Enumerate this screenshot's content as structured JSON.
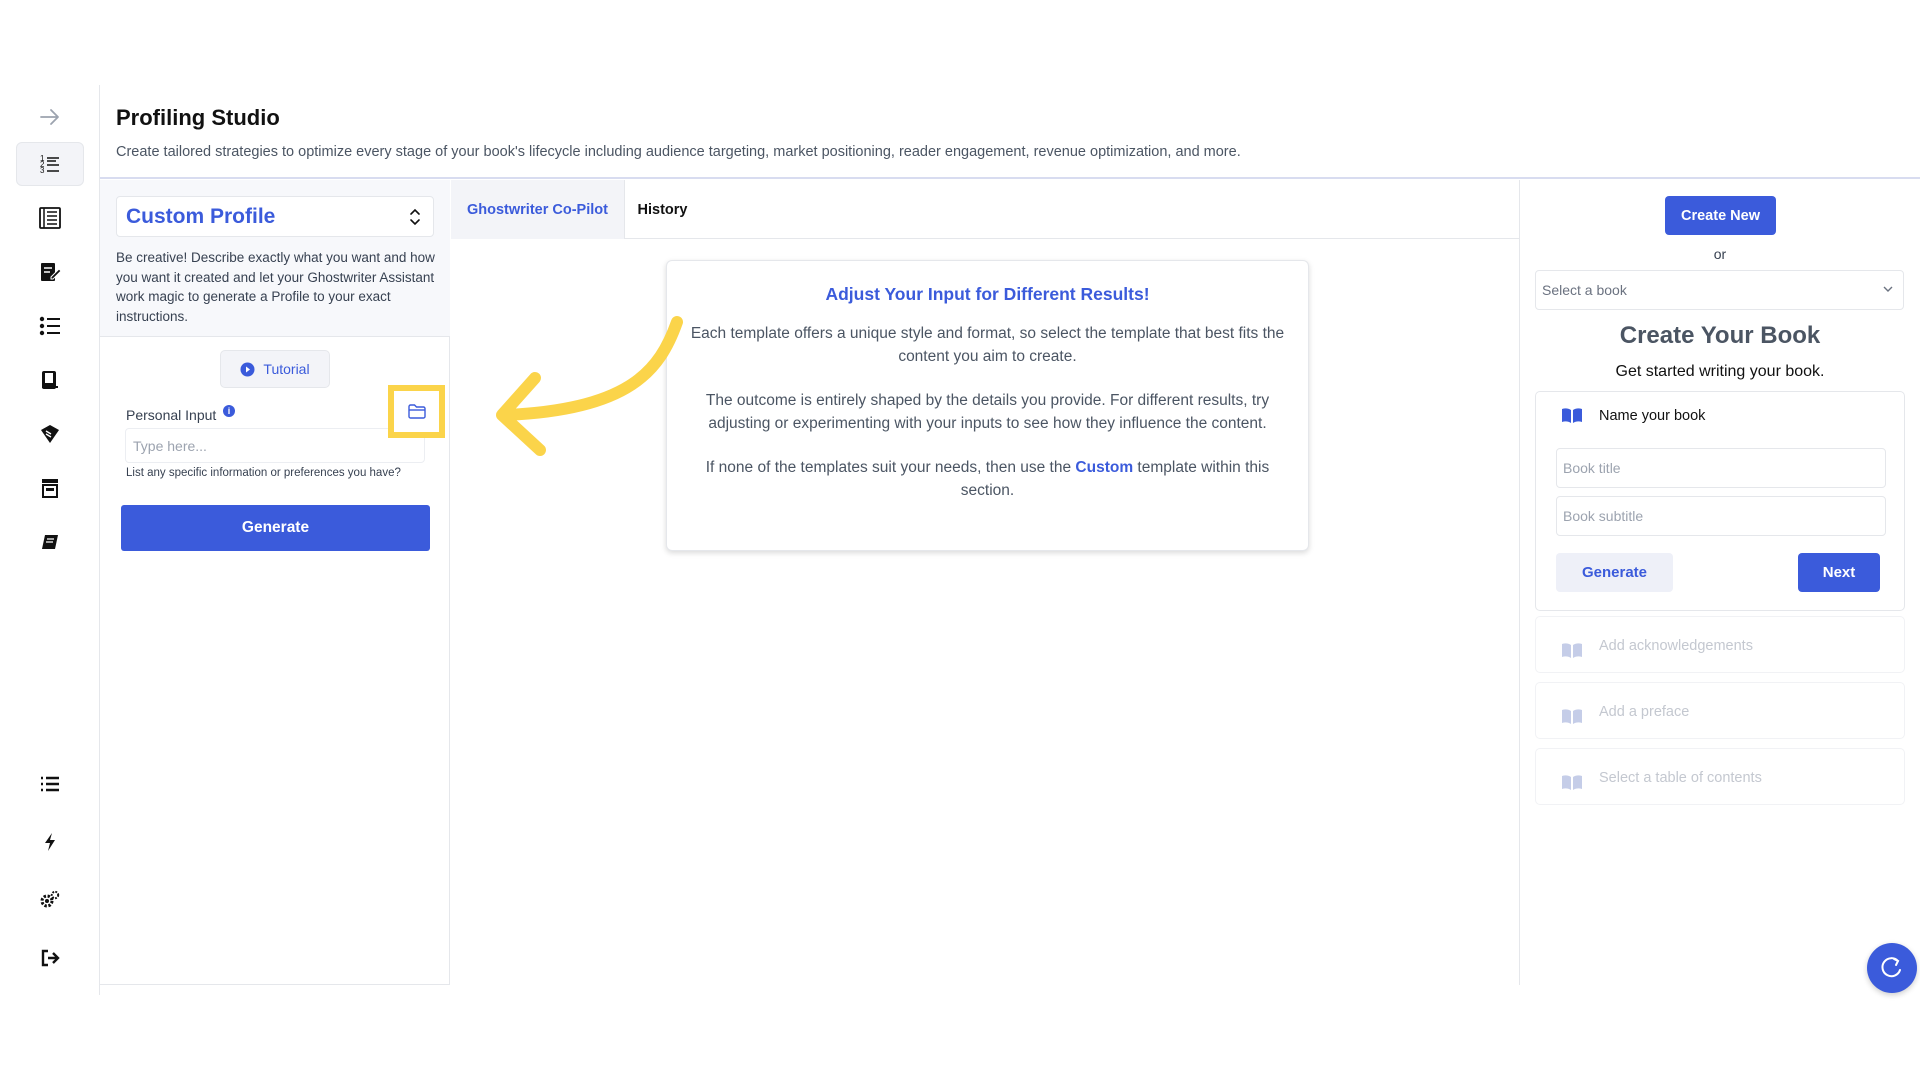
{
  "header": {
    "title": "Profiling Studio",
    "description": "Create tailored strategies to optimize every stage of your book's lifecycle including audience targeting, market positioning, reader engagement, revenue optimization, and more."
  },
  "sidebar": {
    "items": [
      {
        "icon": "arrow-right-icon"
      },
      {
        "icon": "list-numbered-icon",
        "active": true
      },
      {
        "icon": "book-list-icon"
      },
      {
        "icon": "edit-note-icon"
      },
      {
        "icon": "checklist-icon"
      },
      {
        "icon": "book-stack-icon"
      },
      {
        "icon": "tag-icon"
      },
      {
        "icon": "storefront-icon"
      },
      {
        "icon": "book-icon"
      },
      {
        "icon": "list-icon"
      },
      {
        "icon": "bolt-icon"
      },
      {
        "icon": "settings-gears-icon"
      },
      {
        "icon": "logout-icon"
      }
    ]
  },
  "left": {
    "profile_select": "Custom Profile",
    "profile_description": "Be creative! Describe exactly what you want and how you want it created and let your Ghostwriter Assistant work magic to generate a Profile to your exact instructions.",
    "tutorial_label": "Tutorial",
    "personal_input_label": "Personal Input",
    "info_badge": "i",
    "personal_input_placeholder": "Type here...",
    "personal_input_hint": "List any specific information or preferences you have?",
    "generate_label": "Generate"
  },
  "center": {
    "tabs": [
      {
        "label": "Ghostwriter Co-Pilot",
        "active": true
      },
      {
        "label": "History",
        "active": false
      }
    ],
    "card": {
      "title": "Adjust Your Input for Different Results!",
      "p1": "Each template offers a unique style and format, so select the template that best fits the content you aim to create.",
      "p2": "The outcome is entirely shaped by the details you provide. For different results, try adjusting or experimenting with your inputs to see how they influence the content.",
      "p3_before": "If none of the templates suit your needs, then use the ",
      "p3_highlight": "Custom",
      "p3_after": " template within this section."
    }
  },
  "right": {
    "create_new_label": "Create New",
    "or_label": "or",
    "select_book_placeholder": "Select a book",
    "create_title": "Create Your Book",
    "create_subtitle": "Get started writing your book.",
    "name_step_label": "Name your book",
    "book_title_placeholder": "Book title",
    "book_subtitle_placeholder": "Book subtitle",
    "generate_label": "Generate",
    "next_label": "Next",
    "steps": [
      {
        "label": "Add acknowledgements"
      },
      {
        "label": "Add a preface"
      },
      {
        "label": "Select a table of contents"
      }
    ]
  },
  "colors": {
    "accent": "#3b5bdb",
    "highlight": "#fbd44a"
  }
}
